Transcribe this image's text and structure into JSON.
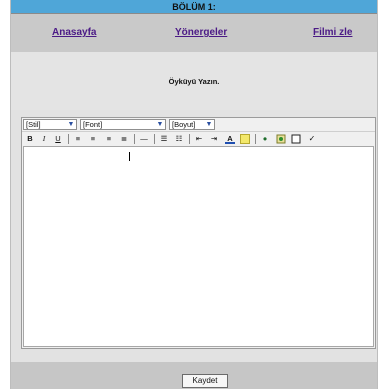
{
  "header": {
    "title": "BÖLÜM 1:"
  },
  "nav": {
    "home": "Anasayfa",
    "instructions": "Yönergeler",
    "watch_film": "Filmi zle"
  },
  "prompt": {
    "text": "Öyküyü Yazın."
  },
  "editor": {
    "style_select": "[Stil]",
    "font_select": "[Font]",
    "size_select": "[Boyut]",
    "content": ""
  },
  "footer": {
    "save_label": "Kaydet"
  }
}
